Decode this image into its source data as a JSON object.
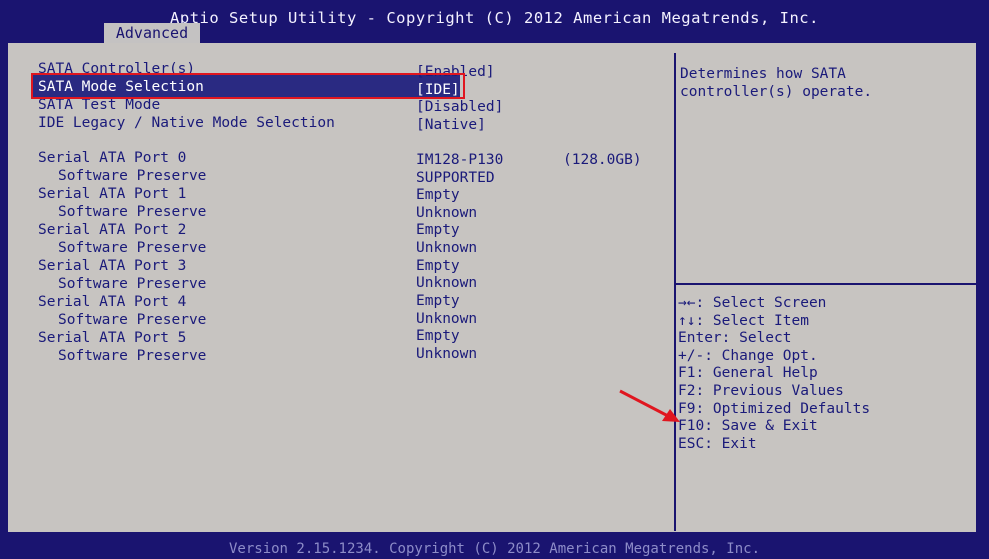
{
  "header": {
    "title": "Aptio Setup Utility - Copyright (C) 2012 American Megatrends, Inc.",
    "tab": "Advanced"
  },
  "settings": [
    {
      "label": "SATA Controller(s)",
      "value": "[Enabled]"
    },
    {
      "label": "SATA Mode Selection",
      "value": "[IDE]"
    },
    {
      "label": "SATA Test Mode",
      "value": "[Disabled]"
    },
    {
      "label": "IDE Legacy / Native Mode Selection",
      "value": "[Native]"
    }
  ],
  "ports": [
    {
      "label": "Serial ATA Port 0",
      "value": "IM128-P130",
      "capacity": "(128.0GB)",
      "sub_label": "Software Preserve",
      "sub_value": "SUPPORTED"
    },
    {
      "label": "Serial ATA Port 1",
      "value": "Empty",
      "sub_label": "Software Preserve",
      "sub_value": "Unknown"
    },
    {
      "label": "Serial ATA Port 2",
      "value": "Empty",
      "sub_label": "Software Preserve",
      "sub_value": "Unknown"
    },
    {
      "label": "Serial ATA Port 3",
      "value": "Empty",
      "sub_label": "Software Preserve",
      "sub_value": "Unknown"
    },
    {
      "label": "Serial ATA Port 4",
      "value": "Empty",
      "sub_label": "Software Preserve",
      "sub_value": "Unknown"
    },
    {
      "label": "Serial ATA Port 5",
      "value": "Empty",
      "sub_label": "Software Preserve",
      "sub_value": "Unknown"
    }
  ],
  "help": {
    "line1": "Determines how SATA",
    "line2": "controller(s) operate."
  },
  "keys": [
    "→←: Select Screen",
    "↑↓: Select Item",
    "Enter: Select",
    "+/-: Change Opt.",
    "F1: General Help",
    "F2: Previous Values",
    "F9: Optimized Defaults",
    "F10: Save & Exit",
    "ESC: Exit"
  ],
  "footer": "Version 2.15.1234. Copyright (C) 2012 American Megatrends, Inc.",
  "colors": {
    "background": "#1a1470",
    "panel": "#c7c4c1",
    "text": "#1a1a7a",
    "annotation": "#e0161f"
  }
}
